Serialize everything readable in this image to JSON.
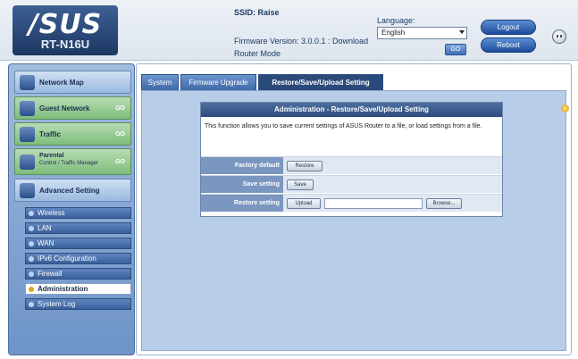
{
  "header": {
    "logo": "/SUS",
    "model": "RT-N16U",
    "sso_label": "SSID: Raise",
    "firmware": "Firmware Version: 3.0.0.1 : Download",
    "mode": "Router Mode",
    "language_label": "Language:",
    "language_value": "English",
    "go_label": "GO",
    "logout_label": "Logout",
    "reboot_label": "Reboot"
  },
  "sidebar": {
    "items": [
      {
        "label": "Network Map"
      },
      {
        "label": "Guest Network",
        "go": "GO"
      },
      {
        "label": "Traffic",
        "go": "GO"
      },
      {
        "label": "Parental",
        "sub": "Control / Traffic Manager",
        "go": "GO"
      },
      {
        "label": "Advanced Setting"
      }
    ],
    "subitems": [
      {
        "label": "Wireless"
      },
      {
        "label": "LAN"
      },
      {
        "label": "WAN"
      },
      {
        "label": "IPv6 Configuration"
      },
      {
        "label": "Firewall"
      },
      {
        "label": "Administration"
      },
      {
        "label": "System Log"
      }
    ],
    "active_subitem": "Administration"
  },
  "tabs": [
    {
      "label": "System"
    },
    {
      "label": "Firmware Upgrade"
    },
    {
      "label": "Restore/Save/Upload Setting"
    }
  ],
  "card": {
    "title": "Administration - Restore/Save/Upload Setting",
    "description": "This function allows you to save current settings of ASUS Router to a file, or load settings from a file.",
    "rows": [
      {
        "label": "Factory default",
        "button": "Restore"
      },
      {
        "label": "Save setting",
        "button": "Save"
      },
      {
        "label": "Restore setting",
        "button": "Upload",
        "browse": "Browse..."
      }
    ]
  },
  "colors": {
    "accent": "#2a4a7a",
    "sidebar_bg": "#8aaad6",
    "panel_bg": "#b8cee8"
  }
}
